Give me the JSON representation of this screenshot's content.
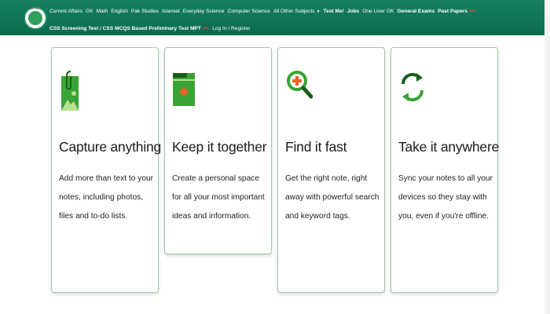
{
  "header": {
    "logo_text": "MCQS PORTAL",
    "nav_row1": [
      {
        "label": "Current Affairs",
        "bold": false
      },
      {
        "label": "GK",
        "bold": false
      },
      {
        "label": "Math",
        "bold": false
      },
      {
        "label": "English",
        "bold": false
      },
      {
        "label": "Pak Studies",
        "bold": false
      },
      {
        "label": "Islamiat",
        "bold": false
      },
      {
        "label": "Everyday Science",
        "bold": false
      },
      {
        "label": "Computer Science",
        "bold": false
      },
      {
        "label": "All Other Subjects",
        "bold": false
      },
      {
        "label": "Test Me!",
        "bold": true
      },
      {
        "label": "Jobs",
        "bold": true
      },
      {
        "label": "One Liner GK",
        "bold": false
      },
      {
        "label": "General Exams",
        "bold": true
      },
      {
        "label": "Past Papers",
        "bold": true
      }
    ],
    "nav_row2": [
      {
        "label": "CSS Screening Test / CSS MCQS Based Preliminary Test MPT",
        "bold": true
      },
      {
        "label": "Log In / Register",
        "bold": false
      }
    ],
    "new_badge": "NEW"
  },
  "cards": [
    {
      "title": "Capture anything",
      "description": "Add more than text to your notes, including photos, files and to-do lists.",
      "icon": "attachment-photo-icon"
    },
    {
      "title": "Keep it together",
      "description": "Create a personal space for all your most important ideas and information.",
      "icon": "folder-icon"
    },
    {
      "title": "Find it fast",
      "description": "Get the right note, right away with powerful search and keyword tags.",
      "icon": "search-icon"
    },
    {
      "title": "Take it anywhere",
      "description": "Sync your notes to all your devices so they stay with you, even if you're offline.",
      "icon": "sync-icon"
    }
  ],
  "colors": {
    "header_bg": "#0f7557",
    "accent_green": "#3aa335",
    "icon_dark": "#1a5e1a",
    "badge_red": "#ff3b3b"
  }
}
